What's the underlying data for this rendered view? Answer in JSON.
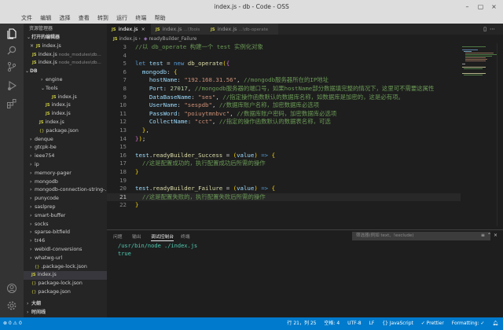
{
  "window": {
    "title": "index.js - db - Code - OSS"
  },
  "menu": [
    "文件",
    "编辑",
    "选择",
    "查看",
    "转到",
    "运行",
    "终端",
    "帮助"
  ],
  "sidebar": {
    "header": "资源管理器",
    "open_editors": "打开的编辑器",
    "rows": [
      {
        "type": "open",
        "close": "×",
        "name": "index.js",
        "path": ""
      },
      {
        "type": "open",
        "close": "",
        "name": "index.js",
        "path": "node_modules\\db..."
      },
      {
        "type": "open",
        "close": "",
        "name": "index.js",
        "path": "node_modules\\db..."
      },
      {
        "type": "section",
        "chev": "⌄",
        "name": "DB"
      },
      {
        "type": "folder",
        "chev": "›",
        "name": "engine",
        "indent": 22
      },
      {
        "type": "folder",
        "chev": "⌄",
        "name": "Tools",
        "indent": 22
      },
      {
        "type": "js",
        "name": "index.js",
        "indent": 30
      },
      {
        "type": "js",
        "name": "index.js",
        "indent": 22
      },
      {
        "type": "js",
        "name": "index.js",
        "indent": 22
      },
      {
        "type": "js",
        "name": "index.js",
        "indent": 14
      },
      {
        "type": "json",
        "name": "package.json",
        "indent": 14
      },
      {
        "type": "folder",
        "chev": "›",
        "name": "denque",
        "indent": 8
      },
      {
        "type": "folder",
        "chev": "›",
        "name": "gtcpk-be",
        "indent": 8
      },
      {
        "type": "folder",
        "chev": "›",
        "name": "ieee754",
        "indent": 8
      },
      {
        "type": "folder",
        "chev": "›",
        "name": "ip",
        "indent": 8
      },
      {
        "type": "folder",
        "chev": "›",
        "name": "memory-pager",
        "indent": 8
      },
      {
        "type": "folder",
        "chev": "›",
        "name": "mongodb",
        "indent": 8
      },
      {
        "type": "folder",
        "chev": "›",
        "name": "mongodb-connection-string-...",
        "indent": 8
      },
      {
        "type": "folder",
        "chev": "›",
        "name": "punycode",
        "indent": 8
      },
      {
        "type": "folder",
        "chev": "›",
        "name": "saslprep",
        "indent": 8
      },
      {
        "type": "folder",
        "chev": "›",
        "name": "smart-buffer",
        "indent": 8
      },
      {
        "type": "folder",
        "chev": "›",
        "name": "socks",
        "indent": 8
      },
      {
        "type": "folder",
        "chev": "›",
        "name": "sparse-bitfield",
        "indent": 8
      },
      {
        "type": "folder",
        "chev": "›",
        "name": "tr46",
        "indent": 8
      },
      {
        "type": "folder",
        "chev": "›",
        "name": "webidl-conversions",
        "indent": 8
      },
      {
        "type": "folder",
        "chev": "›",
        "name": "whatwg-url",
        "indent": 8
      },
      {
        "type": "json",
        "name": ".package-lock.json",
        "indent": 8
      },
      {
        "type": "js",
        "name": "index.js",
        "indent": 4,
        "selected": true
      },
      {
        "type": "json",
        "name": "package-lock.json",
        "indent": 4
      },
      {
        "type": "json",
        "name": "package.json",
        "indent": 4
      }
    ],
    "outline": "大纲",
    "timeline": "时间线"
  },
  "tabs": [
    {
      "name": "index.js",
      "path": "",
      "active": true
    },
    {
      "name": "index.js",
      "path": "...\\Tools",
      "active": false
    },
    {
      "name": "index.js",
      "path": "...\\db-operate",
      "active": false
    }
  ],
  "breadcrumb": {
    "file": "index.js",
    "symbol": "readyBuilder_Failure"
  },
  "code": [
    {
      "n": 3,
      "html": "<span class=\"cm\">//以 db_operate 构建一个 test 实例化对象</span>"
    },
    {
      "n": 4,
      "html": ""
    },
    {
      "n": 5,
      "html": "<span class=\"kw\">let</span> <span class=\"id\">test</span> <span class=\"pn\">=</span> <span class=\"kw\">new</span> <span class=\"fn\">db_operate</span><span class=\"br\">(</span><span class=\"br2\">{</span>"
    },
    {
      "n": 6,
      "html": "  <span class=\"id\">mongodb</span><span class=\"pn\">:</span> <span class=\"br\">{</span>"
    },
    {
      "n": 7,
      "html": "    <span class=\"id\">hostName</span><span class=\"pn\">:</span> <span class=\"str\">\"192.168.31.56\"</span><span class=\"pn\">,</span> <span class=\"cm\">//mongodb服务器所在的IP地址</span>"
    },
    {
      "n": 8,
      "html": "    <span class=\"id\">Port</span><span class=\"pn\">:</span> <span class=\"num\">27017</span><span class=\"pn\">,</span> <span class=\"cm\">//mongodb服务器的端口号，如果hostName部分数据填完整的情况下，这里可不需要这属性</span>"
    },
    {
      "n": 9,
      "html": "    <span class=\"id\">DataBaseName</span><span class=\"pn\">:</span> <span class=\"str\">\"ses\"</span><span class=\"pn\">,</span> <span class=\"cm\">//指定操作函数默认的数据库名称，如数据库是加密的，这是必有项。</span>"
    },
    {
      "n": 10,
      "html": "    <span class=\"id\">UserName</span><span class=\"pn\">:</span> <span class=\"str\">\"sespdb\"</span><span class=\"pn\">,</span> <span class=\"cm\">//数据库账户名称，加密数据库必选项</span>"
    },
    {
      "n": 11,
      "html": "    <span class=\"id\">PassWord</span><span class=\"pn\">:</span> <span class=\"str\">\"poiuytmnbvc\"</span><span class=\"pn\">,</span> <span class=\"cm\">//数据库账户密码，加密数据库必选项</span>"
    },
    {
      "n": 12,
      "html": "    <span class=\"id\">CollectName</span><span class=\"pn\">:</span> <span class=\"str\">\"cct\"</span><span class=\"pn\">,</span> <span class=\"cm\">//指定的操作函数默认的数据表名称，可选</span>"
    },
    {
      "n": 13,
      "html": "  <span class=\"br\">}</span><span class=\"pn\">,</span>"
    },
    {
      "n": 14,
      "html": "<span class=\"br2\">}</span><span class=\"br\">)</span><span class=\"pn\">;</span>"
    },
    {
      "n": 15,
      "html": ""
    },
    {
      "n": 16,
      "html": "<span class=\"id\">test</span><span class=\"pn\">.</span><span class=\"fn\">readyBuilder_Success</span> <span class=\"pn\">=</span> <span class=\"br\">(</span><span class=\"id\">value</span><span class=\"br\">)</span> <span class=\"kw\">=&gt;</span> <span class=\"br\">{</span>"
    },
    {
      "n": 17,
      "html": "  <span class=\"cm\">//这是配置成功的，执行配置成功后所需的操作</span>"
    },
    {
      "n": 18,
      "html": "<span class=\"br\">}</span>"
    },
    {
      "n": 19,
      "html": ""
    },
    {
      "n": 20,
      "html": "<span class=\"id\">test</span><span class=\"pn\">.</span><span class=\"fn\">readyBuilder_Failure</span> <span class=\"pn\">=</span> <span class=\"br\">(</span><span class=\"id\">value</span><span class=\"br\">)</span> <span class=\"kw\">=&gt;</span> <span class=\"br\">{</span>"
    },
    {
      "n": 21,
      "html": "  <span class=\"cm\">//这是配置失败的，执行配置失败后所需的操作</span>",
      "current": true
    },
    {
      "n": 22,
      "html": "<span class=\"br\">}</span>"
    }
  ],
  "panel": {
    "tabs": [
      "问题",
      "输出",
      "调试控制台",
      "终端"
    ],
    "active_tab": 2,
    "filter_placeholder": "筛选器(例如 text、!exclude)",
    "output": [
      "/usr/bin/node ./index.js",
      "true"
    ]
  },
  "status": {
    "left": "⊗ 0 ⚠ 0",
    "items": [
      "行 21，列 25",
      "空格: 4",
      "UTF-8",
      "LF",
      "{} JavaScript",
      "✓ Prettier",
      "Formatting: ✓"
    ]
  }
}
